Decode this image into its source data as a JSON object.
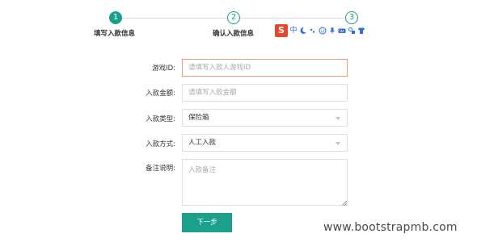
{
  "steps": [
    {
      "number": "1",
      "label": "填写入款信息",
      "state": "active"
    },
    {
      "number": "2",
      "label": "确认入款信息",
      "state": "pending"
    },
    {
      "number": "3",
      "label": "",
      "state": "pending"
    }
  ],
  "ime_toolbar": {
    "logo": "S",
    "items": [
      "中",
      "moon-icon",
      "punctuation-icon",
      "emoji-icon",
      "microphone-icon",
      "keyboard-icon",
      "tools-icon",
      "skin-icon"
    ]
  },
  "form": {
    "game_id": {
      "label": "游戏ID:",
      "placeholder": "请填写入款人游戏ID",
      "value": ""
    },
    "amount": {
      "label": "入款金额:",
      "placeholder": "请填写入款金额",
      "value": ""
    },
    "deposit_type": {
      "label": "入款类型:",
      "value": "保险箱"
    },
    "deposit_method": {
      "label": "入款方式:",
      "value": "人工入款"
    },
    "remark": {
      "label": "备注说明:",
      "placeholder": "入款备注",
      "value": ""
    }
  },
  "next_button": {
    "label": "下一步"
  },
  "watermark": "www.bootstrapmb.com",
  "colors": {
    "accent": "#1aa08b",
    "focus_border": "#f09b7a"
  }
}
